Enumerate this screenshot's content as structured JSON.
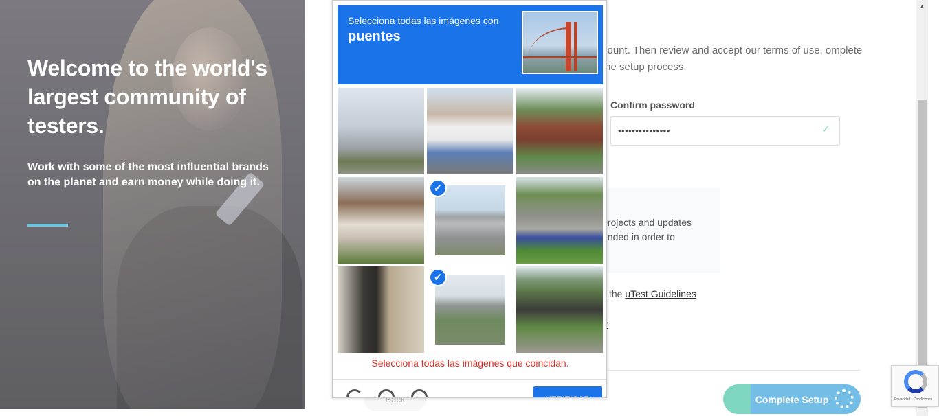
{
  "hero": {
    "title": "Welcome to the world's largest community of testers.",
    "subtitle": "Work with some of the most influential brands on the planet and earn money while doing it.",
    "accent_color": "#74c3dc"
  },
  "form": {
    "intro_fragment": "count. Then review and accept our terms of use, omplete the setup process.",
    "confirm_password_label": "Confirm password",
    "confirm_password_value": "•••••••••••••••",
    "confirm_password_valid_icon": "check-icon",
    "info_fragment": "projects and updates ended in order to",
    "guidelines_prefix": "the",
    "guidelines_link": "uTest Guidelines",
    "privacy_fragment": "y",
    "back_label": "Back",
    "complete_button": "Complete Setup"
  },
  "recaptcha_badge": {
    "links": "Privacidad - Condiciones"
  },
  "captcha": {
    "instruction": "Selecciona todas las imágenes con",
    "keyword": "puentes",
    "sample_image": "golden-gate-bridge",
    "error_message": "Selecciona todas las imágenes que coincidan.",
    "verify_button": "VERIFICAR",
    "tiles": [
      {
        "image": "cloudy-sky-road",
        "selected": false
      },
      {
        "image": "truck-bus-street",
        "selected": false
      },
      {
        "image": "brick-house",
        "selected": false
      },
      {
        "image": "old-house-tree",
        "selected": true
      },
      {
        "image": "elevated-highway-bridge",
        "selected": true
      },
      {
        "image": "overgrown-concrete-structure",
        "selected": false
      },
      {
        "image": "traffic-light-pole",
        "selected": false
      },
      {
        "image": "railway-bridge",
        "selected": true
      },
      {
        "image": "underpass-bridge",
        "selected": false
      }
    ],
    "icons": [
      "reload-icon",
      "audio-icon",
      "info-icon"
    ]
  }
}
